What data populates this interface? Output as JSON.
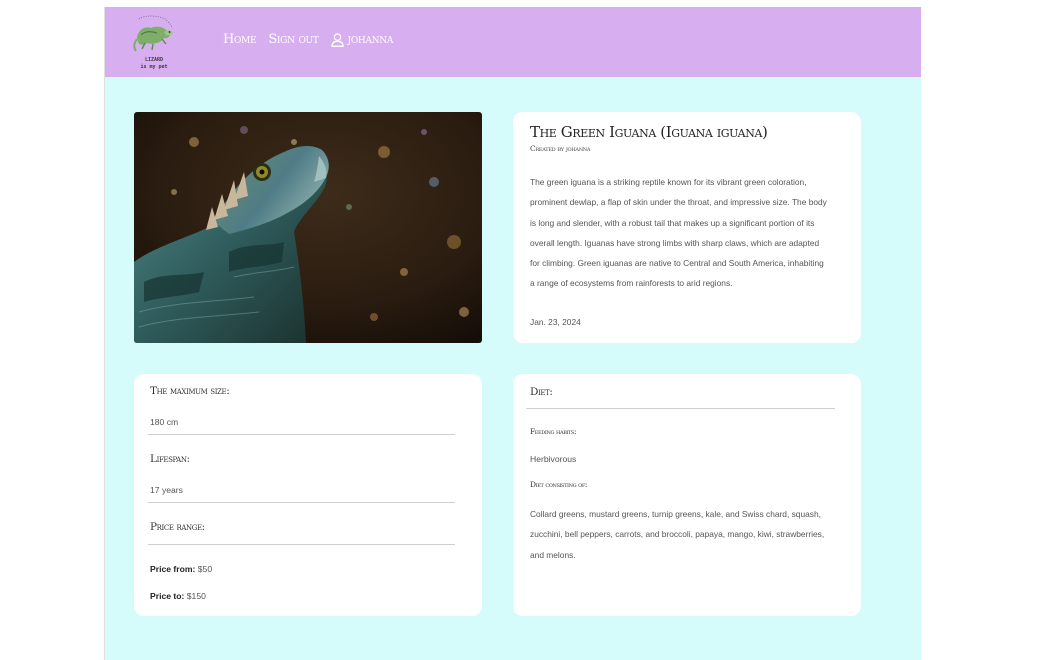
{
  "brand": {
    "logo_line1": "LIZARD",
    "logo_line2": "is my pet"
  },
  "nav": {
    "home": "Home",
    "signout": "Sign out",
    "user": "johanna"
  },
  "article": {
    "image_alt": "green iguana photo",
    "title": "The Green Iguana (Iguana iguana)",
    "created_by": "Created by johanna",
    "description": "The green iguana is a striking reptile known for its vibrant green coloration, prominent dewlap, a flap of skin under the throat, and impressive size. The body is long and slender, with a robust tail that makes up a significant portion of its overall length. Iguanas have strong limbs with sharp claws, which are adapted for climbing. Green iguanas are native to Central and South America, inhabiting a range of ecosystems from rainforests to arid regions.",
    "date": "Jan. 23, 2024"
  },
  "stats": {
    "max_size_label": "The maximum size:",
    "max_size_value": "180 cm",
    "lifespan_label": "Lifespan:",
    "lifespan_value": "17 years",
    "price_label": "Price range:",
    "price_from_label": "Price from:",
    "price_from_value": "$50",
    "price_to_label": "Price to:",
    "price_to_value": "$150"
  },
  "diet": {
    "label": "Diet:",
    "feeding_label": "Feeding habits:",
    "feeding_value": "Herbivorous",
    "consisting_label": "Diet consisting of:",
    "consisting_value": "Collard greens, mustard greens, turnip greens, kale, and Swiss chard, squash, zucchini, bell peppers, carrots, and broccoli, papaya, mango, kiwi, strawberries, and melons."
  },
  "colors": {
    "navbar": "#d7aef0",
    "page_bg": "#d6fbfb",
    "card_bg": "#ffffff"
  },
  "icons": {
    "user": "user-icon",
    "logo": "lizard-logo"
  }
}
